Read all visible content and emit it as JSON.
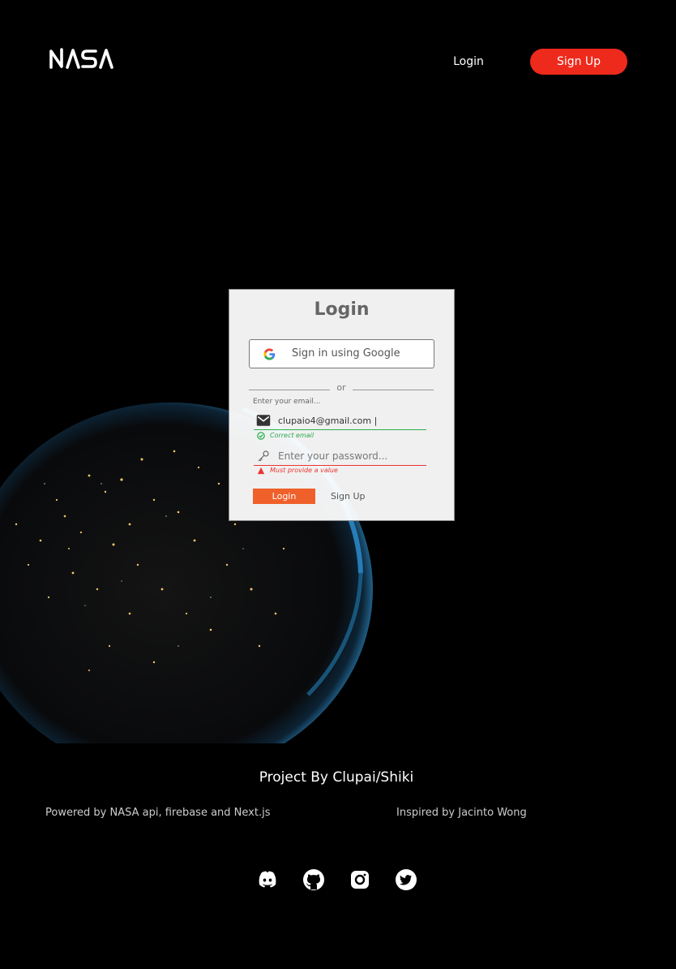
{
  "header": {
    "logo_text": "NASA",
    "login_label": "Login",
    "signup_label": "Sign Up"
  },
  "card": {
    "title": "Login",
    "google_label": "Sign in using Google",
    "or_label": "or",
    "email_label": "Enter your email...",
    "email_value": "clupaio4@gmail.com |",
    "email_hint": "Correct email",
    "password_placeholder": "Enter your password...",
    "password_hint": "Must provide a value",
    "login_label": "Login",
    "signup_label": "Sign Up"
  },
  "footer": {
    "project": "Project By Clupai/Shiki",
    "powered": "Powered by NASA api, firebase and Next.js",
    "inspired": "Inspired by Jacinto Wong",
    "social_icons": [
      "discord-icon",
      "github-icon",
      "instagram-icon",
      "twitter-icon"
    ]
  },
  "colors": {
    "accent_red": "#ee2a1c",
    "card_button": "#f0602a",
    "success": "#27b14b",
    "error": "#ee3333"
  }
}
